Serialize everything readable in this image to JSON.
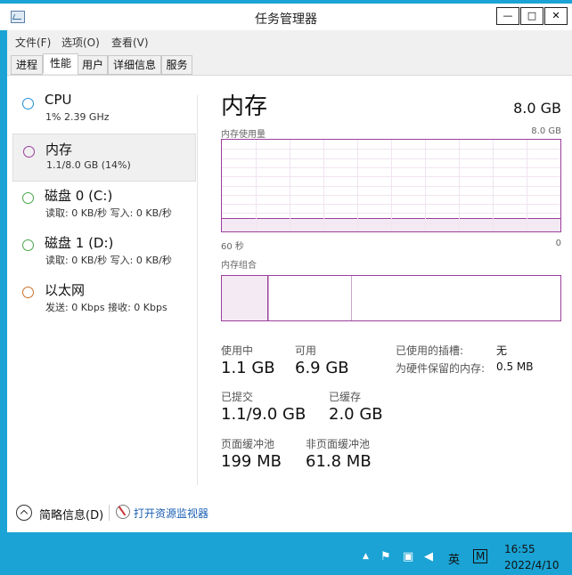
{
  "window": {
    "title": "任务管理器",
    "controls": {
      "minimize": "—",
      "maximize": "□",
      "close": "✕"
    }
  },
  "menu": [
    "文件(F)",
    "选项(O)",
    "查看(V)"
  ],
  "tabs": [
    "进程",
    "性能",
    "用户",
    "详细信息",
    "服务"
  ],
  "active_tab": "性能",
  "sidebar": {
    "items": [
      {
        "title": "CPU",
        "sub": "1% 2.39 GHz",
        "color": "#1f8fd6"
      },
      {
        "title": "内存",
        "sub": "1.1/8.0 GB (14%)",
        "color": "#9b3e9b"
      },
      {
        "title": "磁盘 0 (C:)",
        "sub": "读取: 0 KB/秒  写入: 0 KB/秒",
        "color": "#4aa54a"
      },
      {
        "title": "磁盘 1 (D:)",
        "sub": "读取: 0 KB/秒  写入: 0 KB/秒",
        "color": "#4aa54a"
      },
      {
        "title": "以太网",
        "sub": "发送: 0 Kbps  接收: 0 Kbps",
        "color": "#c8702c"
      }
    ]
  },
  "detail": {
    "title": "内存",
    "total": "8.0 GB",
    "usage_label": "内存使用量",
    "usage_max": "8.0 GB",
    "axis_left": "60 秒",
    "axis_right": "0",
    "composition_label": "内存组合",
    "usage_fraction": 0.14,
    "stats": {
      "in_use_label": "使用中",
      "in_use": "1.1 GB",
      "available_label": "可用",
      "available": "6.9 GB",
      "committed_label": "已提交",
      "committed": "1.1/9.0 GB",
      "cached_label": "已缓存",
      "cached": "2.0 GB",
      "paged_label": "页面缓冲池",
      "paged": "199 MB",
      "nonpaged_label": "非页面缓冲池",
      "nonpaged": "61.8 MB",
      "slots_label": "已使用的插槽:",
      "slots": "无",
      "reserved_label": "为硬件保留的内存:",
      "reserved": "0.5 MB"
    }
  },
  "footer": {
    "less_details": "简略信息(D)",
    "resource_monitor": "打开资源监视器"
  },
  "taskbar": {
    "ime": "英",
    "ime_mode": "M",
    "time": "16:55",
    "date": "2022/4/10"
  }
}
